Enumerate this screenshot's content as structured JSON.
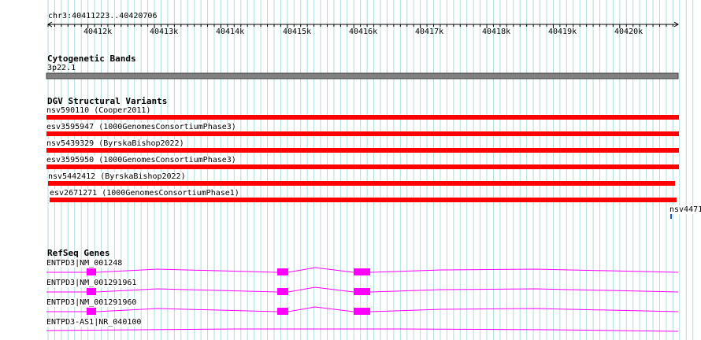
{
  "ruler": {
    "region": "chr3:40411223..40420706",
    "ticks": [
      "40412k",
      "40413k",
      "40414k",
      "40415k",
      "40416k",
      "40417k",
      "40418k",
      "40419k",
      "40420k"
    ]
  },
  "cytoband": {
    "title": "Cytogenetic Bands",
    "band": "3p22.1"
  },
  "dgv": {
    "title": "DGV Structural Variants",
    "variants": [
      {
        "label": "nsv590110  (Cooper2011)"
      },
      {
        "label": "esv3595947  (1000GenomesConsortiumPhase3)"
      },
      {
        "label": "nsv5439329  (ByrskaBishop2022)"
      },
      {
        "label": "esv3595950  (1000GenomesConsortiumPhase3)"
      },
      {
        "label": "nsv5442412  (ByrskaBishop2022)"
      },
      {
        "label": "esv2671271  (1000GenomesConsortiumPhase1)"
      }
    ],
    "edge_label": "nsv4471"
  },
  "refseq": {
    "title": "RefSeq Genes",
    "genes": [
      {
        "label": "ENTPD3|NM_001248"
      },
      {
        "label": "ENTPD3|NM_001291961"
      },
      {
        "label": "ENTPD3|NM_001291960"
      },
      {
        "label": "ENTPD3-AS1|NR_040100"
      }
    ]
  },
  "colors": {
    "grid": "#b0dede",
    "variant": "#ff0000",
    "gene": "#ff00ff",
    "band": "#808080"
  }
}
